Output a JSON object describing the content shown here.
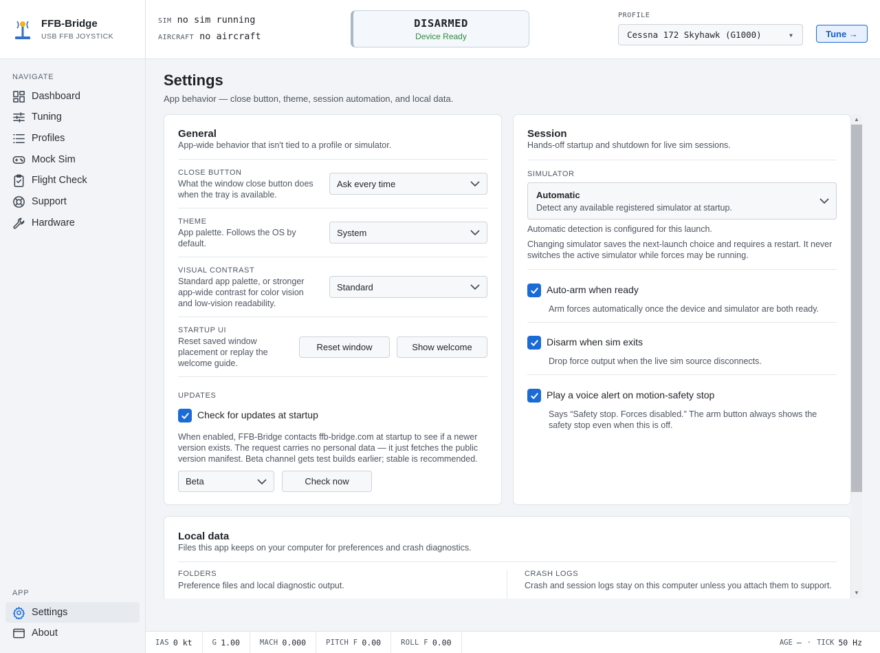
{
  "brand": {
    "title": "FFB-Bridge",
    "subtitle": "USB FFB JOYSTICK"
  },
  "sidebar": {
    "navigate_label": "NAVIGATE",
    "items": [
      {
        "label": "Dashboard",
        "icon": "dashboard-icon"
      },
      {
        "label": "Tuning",
        "icon": "sliders-icon"
      },
      {
        "label": "Profiles",
        "icon": "list-icon"
      },
      {
        "label": "Mock Sim",
        "icon": "gamepad-icon"
      },
      {
        "label": "Flight Check",
        "icon": "clipboard-check-icon"
      },
      {
        "label": "Support",
        "icon": "lifebuoy-icon"
      },
      {
        "label": "Hardware",
        "icon": "wrench-icon"
      }
    ],
    "app_label": "APP",
    "app_items": [
      {
        "label": "Settings",
        "icon": "gear-icon",
        "active": true
      },
      {
        "label": "About",
        "icon": "window-icon"
      }
    ]
  },
  "topbar": {
    "sim_key": "SIM",
    "sim_value": "no sim running",
    "aircraft_key": "AIRCRAFT",
    "aircraft_value": "no aircraft",
    "arm_state": "DISARMED",
    "arm_sub": "Device Ready",
    "profile_label": "PROFILE",
    "profile_value": "Cessna 172 Skyhawk (G1000)",
    "tune_label": "Tune →"
  },
  "page": {
    "title": "Settings",
    "subtitle": "App behavior — close button, theme, session automation, and local data."
  },
  "general": {
    "title": "General",
    "subtitle": "App-wide behavior that isn't tied to a profile or simulator.",
    "close_button": {
      "label": "CLOSE BUTTON",
      "desc": "What the window close button does when the tray is available.",
      "value": "Ask every time"
    },
    "theme": {
      "label": "THEME",
      "desc": "App palette. Follows the OS by default.",
      "value": "System"
    },
    "contrast": {
      "label": "VISUAL CONTRAST",
      "desc": "Standard app palette, or stronger app-wide contrast for color vision and low-vision readability.",
      "value": "Standard"
    },
    "startup": {
      "label": "STARTUP UI",
      "desc": "Reset saved window placement or replay the welcome guide.",
      "reset_label": "Reset window",
      "welcome_label": "Show welcome"
    },
    "updates": {
      "label": "UPDATES",
      "check_label": "Check for updates at startup",
      "help": "When enabled, FFB-Bridge contacts ffb-bridge.com at startup to see if a newer version exists. The request carries no personal data — it just fetches the public version manifest. Beta channel gets test builds earlier; stable is recommended.",
      "channel": "Beta",
      "check_now_label": "Check now"
    }
  },
  "session": {
    "title": "Session",
    "subtitle": "Hands-off startup and shutdown for live sim sessions.",
    "simulator_label": "SIMULATOR",
    "simulator_value": "Automatic",
    "simulator_value_desc": "Detect any available registered simulator at startup.",
    "detect_note": "Automatic detection is configured for this launch.",
    "restart_note": "Changing simulator saves the next-launch choice and requires a restart. It never switches the active simulator while forces may be running.",
    "auto_arm": {
      "label": "Auto-arm when ready",
      "help": "Arm forces automatically once the device and simulator are both ready."
    },
    "disarm": {
      "label": "Disarm when sim exits",
      "help": "Drop force output when the live sim source disconnects."
    },
    "voice": {
      "label": "Play a voice alert on motion-safety stop",
      "help": "Says “Safety stop. Forces disabled.” The arm button always shows the safety stop even when this is off."
    }
  },
  "local_data": {
    "title": "Local data",
    "subtitle": "Files this app keeps on your computer for preferences and crash diagnostics.",
    "folders_label": "FOLDERS",
    "folders_desc": "Preference files and local diagnostic output.",
    "crash_label": "CRASH LOGS",
    "crash_desc": "Crash and session logs stay on this computer unless you attach them to support."
  },
  "statusbar": {
    "ias_key": "IAS",
    "ias_value": "0 kt",
    "g_key": "G",
    "g_value": "1.00",
    "mach_key": "MACH",
    "mach_value": "0.000",
    "pitch_key": "PITCH F",
    "pitch_value": "0.00",
    "roll_key": "ROLL F",
    "roll_value": "0.00",
    "age_key": "AGE",
    "age_value": "—",
    "sep": "·",
    "tick_key": "TICK",
    "tick_value": "50 Hz"
  },
  "colors": {
    "accent": "#1a6bd6",
    "ready": "#2f8b3e"
  }
}
